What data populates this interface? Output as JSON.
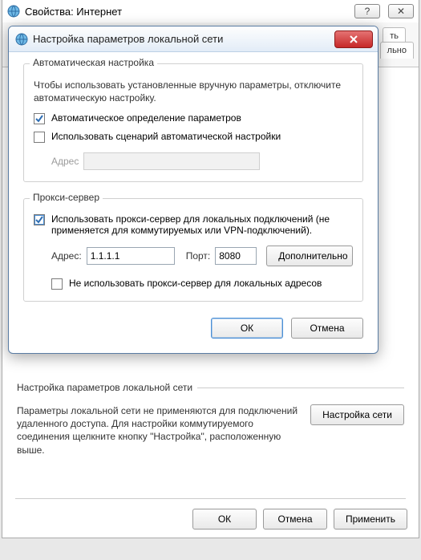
{
  "backWindow": {
    "title": "Свойства: Интернет",
    "help": "?",
    "close": "✕",
    "tabPeek1": "ть",
    "tabPeek2": "льно",
    "lanSectionTitle": "Настройка параметров локальной сети",
    "lanDesc": "Параметры локальной сети не применяются для подключений удаленного доступа. Для настройки коммутируемого соединения щелкните кнопку \"Настройка\", расположенную выше.",
    "lanBtn": "Настройка сети",
    "ok": "ОК",
    "cancel": "Отмена",
    "apply": "Применить"
  },
  "lanDialog": {
    "title": "Настройка параметров локальной сети",
    "close": "✕",
    "auto": {
      "legend": "Автоматическая настройка",
      "note": "Чтобы использовать установленные вручную параметры, отключите автоматическую настройку.",
      "cbAutoDetect": "Автоматическое определение параметров",
      "cbUseScript": "Использовать сценарий автоматической настройки",
      "addressLabel": "Адрес",
      "addressValue": ""
    },
    "proxy": {
      "legend": "Прокси-сервер",
      "cbUseProxy": "Использовать прокси-сервер для локальных подключений (не применяется для коммутируемых или VPN-подключений).",
      "addressLabel": "Адрес:",
      "addressValue": "1.1.1.1",
      "portLabel": "Порт:",
      "portValue": "8080",
      "advanced": "Дополнительно",
      "cbBypassLocal": "Не использовать прокси-сервер для локальных адресов"
    },
    "ok": "ОК",
    "cancel": "Отмена"
  }
}
